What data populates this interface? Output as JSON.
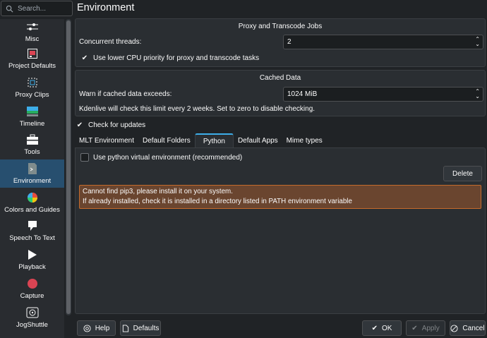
{
  "search": {
    "placeholder": "Search..."
  },
  "page_title": "Environment",
  "sidebar": {
    "items": [
      {
        "label": "Misc",
        "icon": "sliders-icon"
      },
      {
        "label": "Project Defaults",
        "icon": "project-icon"
      },
      {
        "label": "Proxy Clips",
        "icon": "proxy-icon"
      },
      {
        "label": "Timeline",
        "icon": "timeline-icon"
      },
      {
        "label": "Tools",
        "icon": "toolbox-icon"
      },
      {
        "label": "Environment",
        "icon": "terminal-icon",
        "active": true
      },
      {
        "label": "Colors and Guides",
        "icon": "color-wheel-icon"
      },
      {
        "label": "Speech To Text",
        "icon": "speech-icon"
      },
      {
        "label": "Playback",
        "icon": "play-icon"
      },
      {
        "label": "Capture",
        "icon": "record-icon"
      },
      {
        "label": "JogShuttle",
        "icon": "jogshuttle-icon"
      }
    ]
  },
  "proxy": {
    "title": "Proxy and Transcode Jobs",
    "threads_label": "Concurrent threads:",
    "threads_value": "2",
    "low_priority_label": "Use lower CPU priority for proxy and transcode tasks",
    "low_priority_checked": true
  },
  "cache": {
    "title": "Cached Data",
    "warn_label": "Warn if cached data exceeds:",
    "warn_value": "1024 MiB",
    "info": "Kdenlive will check this limit every 2 weeks. Set to zero to disable checking."
  },
  "check_updates": {
    "label": "Check for updates",
    "checked": true
  },
  "tabs": [
    {
      "label": "MLT Environment"
    },
    {
      "label": "Default Folders"
    },
    {
      "label": "Python",
      "active": true
    },
    {
      "label": "Default Apps"
    },
    {
      "label": "Mime types"
    }
  ],
  "python": {
    "venv_label": "Use python virtual environment (recommended)",
    "venv_checked": false,
    "delete_label": "Delete",
    "error_line1": "Cannot find pip3, please install it on your system.",
    "error_line2": "If already installed, check it is installed in a directory listed in PATH environment variable"
  },
  "footer": {
    "help": "Help",
    "defaults": "Defaults",
    "ok": "OK",
    "apply": "Apply",
    "cancel": "Cancel"
  },
  "colors": {
    "accent": "#3daee9",
    "active_item": "#274f6f",
    "error_bg": "#6a452f",
    "error_border": "#c46a2c",
    "record_red": "#da4453"
  }
}
